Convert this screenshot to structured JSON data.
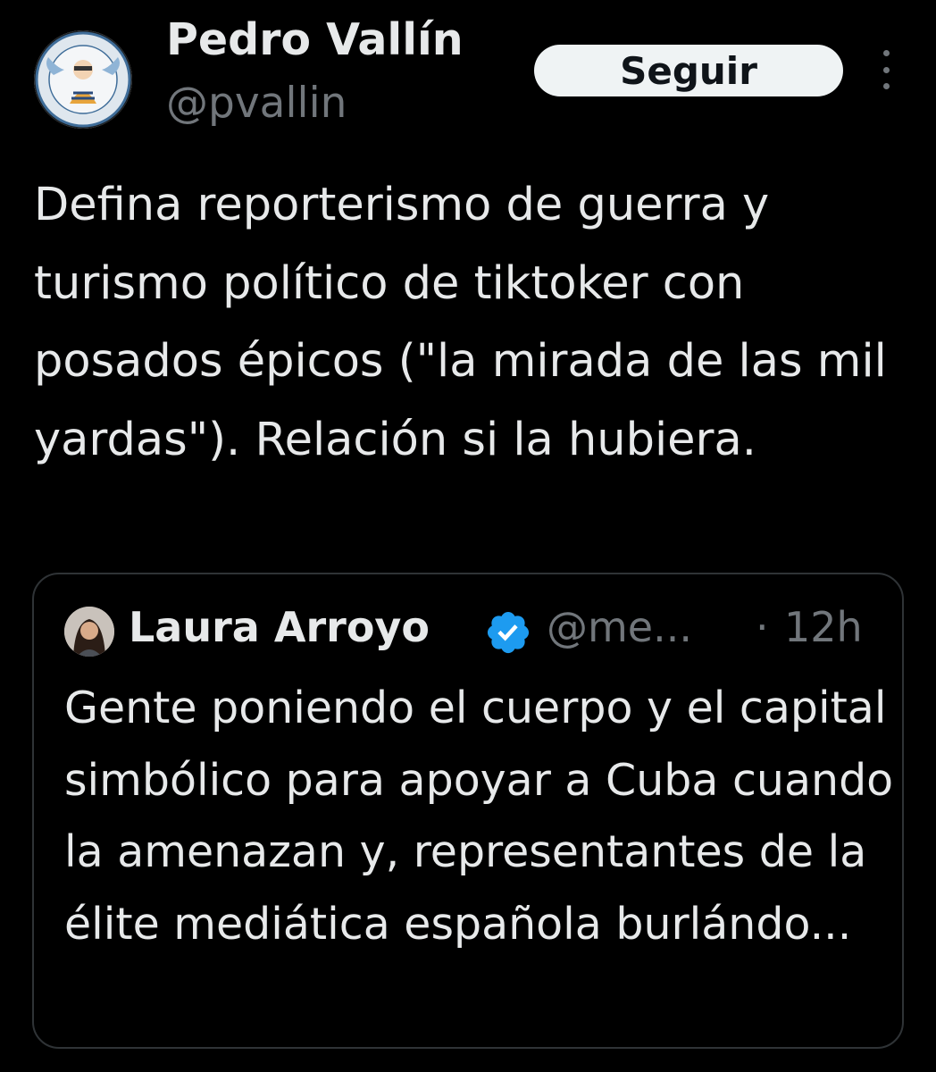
{
  "tweet": {
    "author_name": "Pedro Vallín",
    "author_handle": "@pvallin",
    "follow_label": "Seguir",
    "avatar_icon": "author-avatar",
    "text": "Defina reporterismo de guerra y turismo político de tiktoker con posados épicos (\"la mirada de las mil yardas\"). Relación si la hubiera."
  },
  "quote": {
    "author_name": "Laura Arroyo",
    "author_handle": "@me...",
    "separator": "·",
    "time": "12h",
    "verified_icon": "verified-badge-icon",
    "text": "Gente poniendo el cuerpo y el capital simbólico para apoyar a Cuba cuando la amenazan y, representantes de la élite mediática española burlándo..."
  },
  "colors": {
    "background": "#000000",
    "text_primary": "#e7e9ea",
    "text_secondary": "#71767b",
    "button_bg": "#eff3f4",
    "button_text": "#0f1419",
    "border": "#2f3336",
    "verified_blue": "#1d9bf0"
  }
}
